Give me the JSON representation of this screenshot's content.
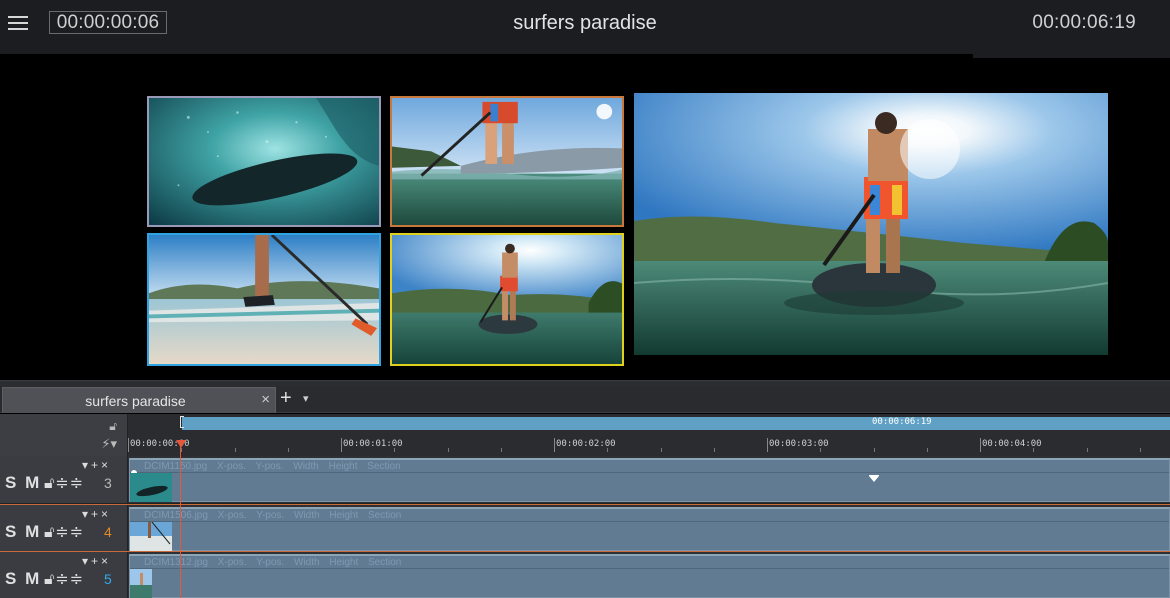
{
  "header": {
    "current_timecode": "00:00:00:06",
    "project_title": "surfers paradise",
    "total_duration": "00:00:06:19"
  },
  "preview": {
    "tiles": [
      {
        "name": "underwater-board",
        "border_color": "#9a9ab8"
      },
      {
        "name": "paddler-legs-waterline",
        "border_color": "#c8783a"
      },
      {
        "name": "feet-on-board",
        "border_color": "#2fa4e0"
      },
      {
        "name": "paddler-small-sun",
        "border_color": "#e0d21c"
      },
      {
        "name": "paddler-large-sun",
        "border_color": "#000000"
      }
    ]
  },
  "timeline": {
    "tab_label": "surfers paradise",
    "tab_close": "×",
    "add_tab": "+",
    "tab_menu": "▾",
    "range_timecode": "00:00:06:19",
    "ticks": [
      "00:00:00:00",
      "00:00:01:00",
      "00:00:02:00",
      "00:00:03:00",
      "00:00:04:00"
    ],
    "tracks": [
      {
        "number": "3",
        "number_color": "#b9b9b9",
        "file": "DCIM1150.jpg",
        "fields": [
          "X-pos.",
          "Y-pos.",
          "Width",
          "Height",
          "Section"
        ]
      },
      {
        "number": "4",
        "number_color": "#e08a2a",
        "file": "DCIM1506.jpg",
        "fields": [
          "X-pos.",
          "Y-pos.",
          "Width",
          "Height",
          "Section"
        ]
      },
      {
        "number": "5",
        "number_color": "#33a9e6",
        "file": "DCIM1312.jpg",
        "fields": [
          "X-pos.",
          "Y-pos.",
          "Width",
          "Height",
          "Section"
        ]
      }
    ],
    "track_controls": {
      "solo": "S",
      "mute": "M",
      "lock": "🔓︎",
      "expand": "≑",
      "collapse": "≑",
      "down": "▾",
      "add": "+",
      "remove": "×"
    }
  }
}
